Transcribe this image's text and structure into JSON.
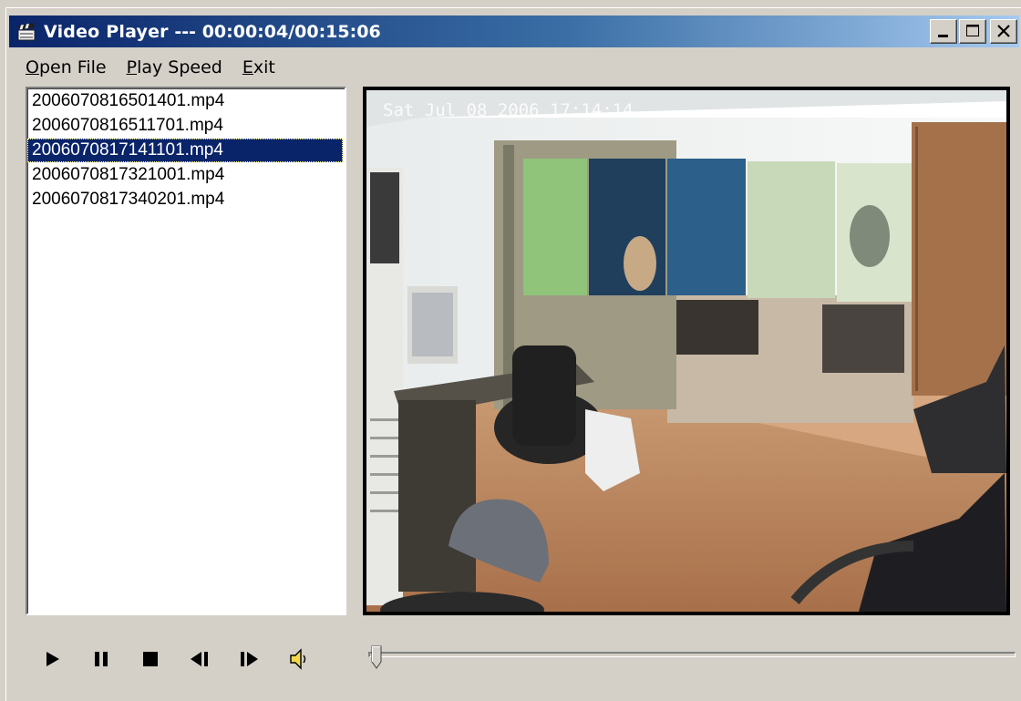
{
  "window": {
    "title": "Video Player",
    "separator": "---",
    "time_display": "00:00:04/00:15:06",
    "buttons": {
      "minimize": "minimize",
      "maximize": "maximize",
      "close": "close"
    }
  },
  "menu": {
    "items": [
      {
        "label": "Open File",
        "mnemonic": "O"
      },
      {
        "label": "Play Speed",
        "mnemonic": "P"
      },
      {
        "label": "Exit",
        "mnemonic": "E"
      }
    ]
  },
  "file_list": {
    "files": [
      "2006070816501401.mp4",
      "2006070816511701.mp4",
      "2006070817141101.mp4",
      "2006070817321001.mp4",
      "2006070817340201.mp4"
    ],
    "selected_index": 2
  },
  "video": {
    "overlay_text": "Sat Jul 08 2006 17:14:14",
    "scene": "office-camera-frame"
  },
  "controls": {
    "icons": [
      "play-icon",
      "pause-icon",
      "stop-icon",
      "step-back-icon",
      "step-forward-icon",
      "volume-icon"
    ]
  },
  "seek": {
    "position_seconds": 4,
    "duration_seconds": 906
  },
  "colors": {
    "titlebar_start": "#0a246a",
    "titlebar_end": "#a6caf0",
    "selection": "#0a246a",
    "face": "#d4d0c8"
  }
}
